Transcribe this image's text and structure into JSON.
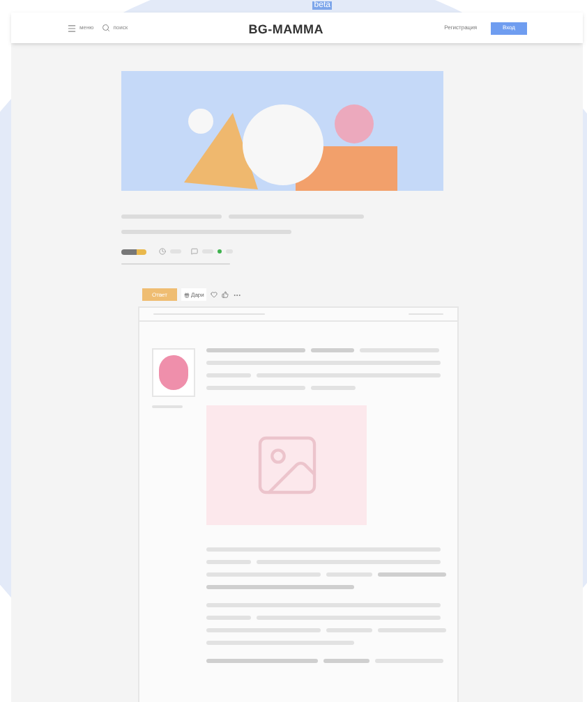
{
  "header": {
    "menu_label": "меню",
    "search_label": "поиск",
    "logo": "BG-MAMMA",
    "logo_badge": "beta",
    "register_link": "Регистрация",
    "login_button": "Вход"
  },
  "post_actions": {
    "reply_button": "Ответ",
    "gift_button": "Дари"
  }
}
